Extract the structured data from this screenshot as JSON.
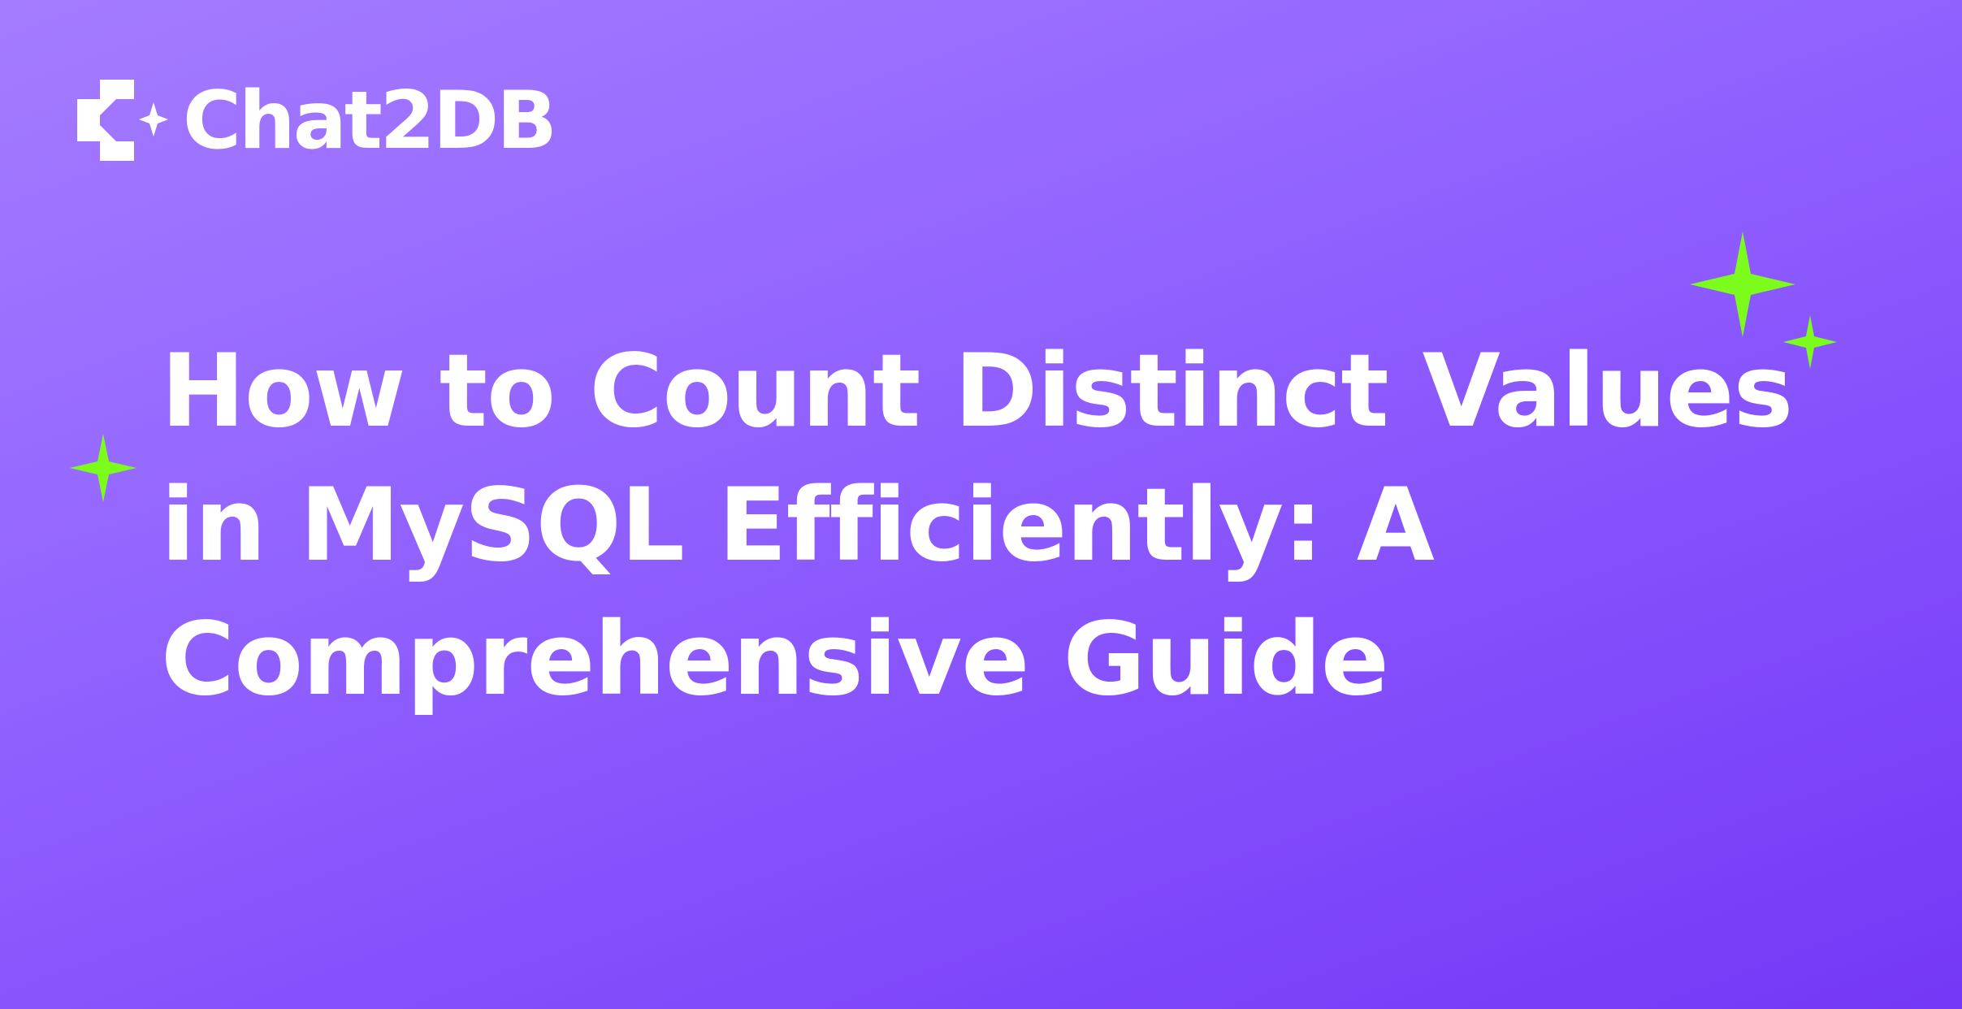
{
  "brand": {
    "name": "Chat2DB",
    "logo_icon": "chat2db-logo-icon"
  },
  "headline": {
    "lines": [
      "How to Count Distinct Values",
      "in MySQL Efficiently: A",
      "Comprehensive Guide"
    ]
  },
  "decorations": {
    "sparkle_icon": "four-point-star-icon",
    "sparkle_color": "#7cfc1c"
  },
  "colors": {
    "background_start": "#a47cff",
    "background_end": "#7438f6",
    "text": "#ffffff",
    "accent": "#7cfc1c"
  }
}
